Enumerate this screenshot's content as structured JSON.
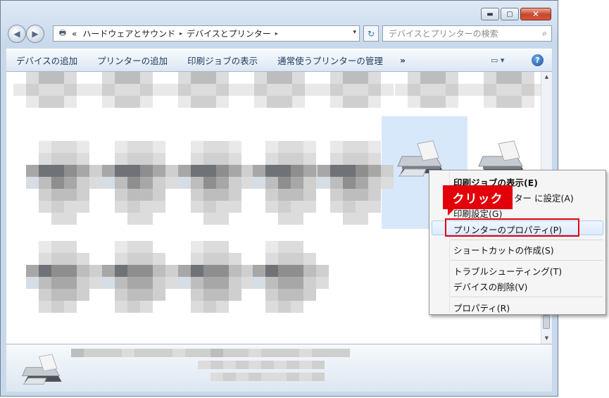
{
  "window": {
    "minimize_icon": "minimize-icon",
    "maximize_icon": "maximize-icon",
    "close_icon": "close-icon",
    "minimize_glyph": "▬",
    "maximize_glyph": "▢",
    "close_glyph": "✕"
  },
  "address": {
    "prefix": "«",
    "crumbs": [
      "ハードウェアとサウンド",
      "デバイスとプリンター"
    ],
    "separator": "▸",
    "dropdown": "▾",
    "refresh": "↻"
  },
  "search": {
    "placeholder": "デバイスとプリンターの検索",
    "icon_glyph": "⌕"
  },
  "toolbar": {
    "add_device": "デバイスの追加",
    "add_printer": "プリンターの追加",
    "show_print_jobs": "印刷ジョブの表示",
    "manage_default_printers": "通常使うプリンターの管理",
    "more": "»",
    "view_glyph": "▭ ▾",
    "help_glyph": "?"
  },
  "context_menu": {
    "items": [
      {
        "label": "印刷ジョブの表示(E)",
        "bold": true
      },
      {
        "label": "ター に設定(A)"
      },
      {
        "label": "印刷設定(G)"
      },
      {
        "label": "プリンターのプロパティ(P)"
      },
      {
        "label": "ショートカットの作成(S)"
      },
      {
        "label": "トラブルシューティング(T)"
      },
      {
        "label": "デバイスの削除(V)"
      },
      {
        "label": "プロパティ(R)"
      }
    ]
  },
  "annotation": {
    "callout": "クリック",
    "color": "#e4000a"
  },
  "colors": {
    "accent": "#1e395b",
    "highlight": "#dcebfc"
  }
}
